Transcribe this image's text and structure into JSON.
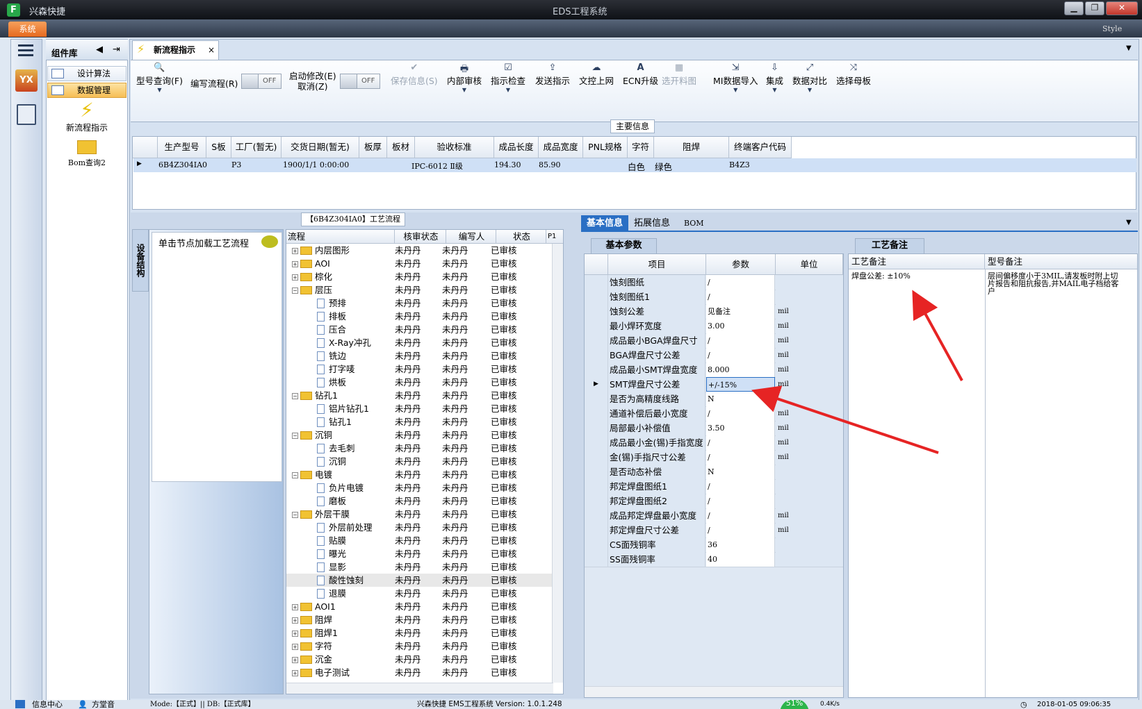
{
  "titlebar": {
    "app_name": "兴森快捷",
    "window_title": "EDS工程系统",
    "app_icon_letter": "F",
    "style_label": "Style",
    "min": "▁",
    "max": "❐",
    "close": "✕"
  },
  "ribbon": {
    "system_tab": "系统"
  },
  "sidebar": {
    "title": "组件库",
    "items": [
      {
        "label": "设计算法",
        "selected": false
      },
      {
        "label": "数据管理",
        "selected": true
      }
    ],
    "tools": [
      {
        "label": "新流程指示",
        "icon": "lightning-icon"
      },
      {
        "label": "Bom查询2",
        "icon": "folder-open-icon"
      }
    ]
  },
  "doc_tab": {
    "label": "新流程指示",
    "close": "×"
  },
  "toolbar": {
    "buttons": [
      {
        "label": "型号查询(F)",
        "icon": "🔍",
        "disabled": false
      },
      {
        "label": "编写流程(R)",
        "icon": "",
        "disabled": false
      },
      {
        "label": "启动修改(E)",
        "label2": "取消(Z)",
        "icon": "",
        "disabled": false
      },
      {
        "label": "保存信息(S)",
        "icon": "✔",
        "disabled": true
      },
      {
        "label": "内部审核",
        "icon": "🖶",
        "disabled": false
      },
      {
        "label": "指示检查",
        "icon": "☑",
        "disabled": false
      },
      {
        "label": "发送指示",
        "icon": "⇪",
        "disabled": false
      },
      {
        "label": "文控上网",
        "icon": "☁",
        "disabled": false
      },
      {
        "label": "ECN升级",
        "icon": "A",
        "disabled": false
      },
      {
        "label": "选开料图",
        "icon": "▦",
        "disabled": true
      },
      {
        "label": "MI数据导入",
        "icon": "⇲",
        "disabled": false
      },
      {
        "label": "集成",
        "icon": "⇩",
        "disabled": false
      },
      {
        "label": "数据对比",
        "icon": "⤢",
        "disabled": false
      },
      {
        "label": "选择母板",
        "icon": "⤨",
        "disabled": false
      }
    ],
    "toggle1": "OFF",
    "toggle2": "OFF"
  },
  "main_info": {
    "title": "主要信息",
    "columns": [
      "生产型号",
      "S板",
      "工厂(暂无)",
      "交货日期(暂无)",
      "板厚",
      "板材",
      "验收标准",
      "成品长度",
      "成品宽度",
      "PNL规格",
      "字符",
      "阻焊",
      "终端客户代码"
    ],
    "row": [
      "6B4Z304IA0",
      "",
      "P3",
      "1900/1/1 0:00:00",
      "",
      "",
      "IPC-6012 Ⅱ级",
      "194.30",
      "85.90",
      "",
      "白色",
      "绿色",
      "B4Z3"
    ]
  },
  "flow_panel": {
    "title": "【6B4Z304IA0】工艺流程",
    "side_tab": "设备结构",
    "hint": "单击节点加载工艺流程",
    "columns": [
      "流程",
      "核审状态",
      "编写人",
      "状态",
      "P1"
    ],
    "rows": [
      {
        "name": "内层图形",
        "type": "folder",
        "level": 0,
        "exp": "+",
        "a": "未丹丹",
        "b": "未丹丹",
        "c": "已审核"
      },
      {
        "name": "AOI",
        "type": "folder",
        "level": 0,
        "exp": "+",
        "a": "未丹丹",
        "b": "未丹丹",
        "c": "已审核"
      },
      {
        "name": "棕化",
        "type": "folder",
        "level": 0,
        "exp": "+",
        "a": "未丹丹",
        "b": "未丹丹",
        "c": "已审核"
      },
      {
        "name": "层压",
        "type": "folder",
        "level": 0,
        "exp": "−",
        "a": "未丹丹",
        "b": "未丹丹",
        "c": "已审核"
      },
      {
        "name": "预排",
        "type": "doc",
        "level": 1,
        "exp": "",
        "a": "未丹丹",
        "b": "未丹丹",
        "c": "已审核"
      },
      {
        "name": "排板",
        "type": "doc",
        "level": 1,
        "exp": "",
        "a": "未丹丹",
        "b": "未丹丹",
        "c": "已审核"
      },
      {
        "name": "压合",
        "type": "doc",
        "level": 1,
        "exp": "",
        "a": "未丹丹",
        "b": "未丹丹",
        "c": "已审核"
      },
      {
        "name": "X-Ray冲孔",
        "type": "doc",
        "level": 1,
        "exp": "",
        "a": "未丹丹",
        "b": "未丹丹",
        "c": "已审核"
      },
      {
        "name": "铣边",
        "type": "doc",
        "level": 1,
        "exp": "",
        "a": "未丹丹",
        "b": "未丹丹",
        "c": "已审核"
      },
      {
        "name": "打字唛",
        "type": "doc",
        "level": 1,
        "exp": "",
        "a": "未丹丹",
        "b": "未丹丹",
        "c": "已审核"
      },
      {
        "name": "烘板",
        "type": "doc",
        "level": 1,
        "exp": "",
        "a": "未丹丹",
        "b": "未丹丹",
        "c": "已审核"
      },
      {
        "name": "钻孔1",
        "type": "folder",
        "level": 0,
        "exp": "−",
        "a": "未丹丹",
        "b": "未丹丹",
        "c": "已审核"
      },
      {
        "name": "铝片钻孔1",
        "type": "doc",
        "level": 1,
        "exp": "",
        "a": "未丹丹",
        "b": "未丹丹",
        "c": "已审核"
      },
      {
        "name": "钻孔1",
        "type": "doc",
        "level": 1,
        "exp": "",
        "a": "未丹丹",
        "b": "未丹丹",
        "c": "已审核"
      },
      {
        "name": "沉铜",
        "type": "folder",
        "level": 0,
        "exp": "−",
        "a": "未丹丹",
        "b": "未丹丹",
        "c": "已审核"
      },
      {
        "name": "去毛刺",
        "type": "doc",
        "level": 1,
        "exp": "",
        "a": "未丹丹",
        "b": "未丹丹",
        "c": "已审核"
      },
      {
        "name": "沉铜",
        "type": "doc",
        "level": 1,
        "exp": "",
        "a": "未丹丹",
        "b": "未丹丹",
        "c": "已审核"
      },
      {
        "name": "电镀",
        "type": "folder",
        "level": 0,
        "exp": "−",
        "a": "未丹丹",
        "b": "未丹丹",
        "c": "已审核"
      },
      {
        "name": "负片电镀",
        "type": "doc",
        "level": 1,
        "exp": "",
        "a": "未丹丹",
        "b": "未丹丹",
        "c": "已审核"
      },
      {
        "name": "磨板",
        "type": "doc",
        "level": 1,
        "exp": "",
        "a": "未丹丹",
        "b": "未丹丹",
        "c": "已审核"
      },
      {
        "name": "外层干膜",
        "type": "folder",
        "level": 0,
        "exp": "−",
        "a": "未丹丹",
        "b": "未丹丹",
        "c": "已审核"
      },
      {
        "name": "外层前处理",
        "type": "doc",
        "level": 1,
        "exp": "",
        "a": "未丹丹",
        "b": "未丹丹",
        "c": "已审核"
      },
      {
        "name": "贴膜",
        "type": "doc",
        "level": 1,
        "exp": "",
        "a": "未丹丹",
        "b": "未丹丹",
        "c": "已审核"
      },
      {
        "name": "曝光",
        "type": "doc",
        "level": 1,
        "exp": "",
        "a": "未丹丹",
        "b": "未丹丹",
        "c": "已审核"
      },
      {
        "name": "显影",
        "type": "doc",
        "level": 1,
        "exp": "",
        "a": "未丹丹",
        "b": "未丹丹",
        "c": "已审核"
      },
      {
        "name": "酸性蚀刻",
        "type": "doc",
        "level": 1,
        "exp": "",
        "a": "未丹丹",
        "b": "未丹丹",
        "c": "已审核",
        "sel": true
      },
      {
        "name": "退膜",
        "type": "doc",
        "level": 1,
        "exp": "",
        "a": "未丹丹",
        "b": "未丹丹",
        "c": "已审核"
      },
      {
        "name": "AOI1",
        "type": "folder",
        "level": 0,
        "exp": "+",
        "a": "未丹丹",
        "b": "未丹丹",
        "c": "已审核"
      },
      {
        "name": "阻焊",
        "type": "folder",
        "level": 0,
        "exp": "+",
        "a": "未丹丹",
        "b": "未丹丹",
        "c": "已审核"
      },
      {
        "name": "阻焊1",
        "type": "folder",
        "level": 0,
        "exp": "+",
        "a": "未丹丹",
        "b": "未丹丹",
        "c": "已审核"
      },
      {
        "name": "字符",
        "type": "folder",
        "level": 0,
        "exp": "+",
        "a": "未丹丹",
        "b": "未丹丹",
        "c": "已审核"
      },
      {
        "name": "沉金",
        "type": "folder",
        "level": 0,
        "exp": "+",
        "a": "未丹丹",
        "b": "未丹丹",
        "c": "已审核"
      },
      {
        "name": "电子测试",
        "type": "folder",
        "level": 0,
        "exp": "+",
        "a": "未丹丹",
        "b": "未丹丹",
        "c": "已审核"
      }
    ]
  },
  "right_tabs": [
    "基本信息",
    "拓展信息",
    "BOM"
  ],
  "params": {
    "subtab": "基本参数",
    "columns": [
      "项目",
      "参数",
      "单位"
    ],
    "rows": [
      {
        "k": "蚀刻图纸",
        "v": "/",
        "u": ""
      },
      {
        "k": "蚀刻图纸1",
        "v": "/",
        "u": ""
      },
      {
        "k": "蚀刻公差",
        "v": "见备注",
        "u": "mil"
      },
      {
        "k": "最小焊环宽度",
        "v": "3.00",
        "u": "mil"
      },
      {
        "k": "成品最小BGA焊盘尺寸",
        "v": "/",
        "u": "mil"
      },
      {
        "k": "BGA焊盘尺寸公差",
        "v": "/",
        "u": "mil"
      },
      {
        "k": "成品最小SMT焊盘宽度",
        "v": "8.000",
        "u": "mil"
      },
      {
        "k": "SMT焊盘尺寸公差",
        "v": "+/-15%",
        "u": "mil",
        "cur": true
      },
      {
        "k": "是否为高精度线路",
        "v": "N",
        "u": ""
      },
      {
        "k": "通道补偿后最小宽度",
        "v": "/",
        "u": "mil"
      },
      {
        "k": "局部最小补偿值",
        "v": "3.50",
        "u": "mil"
      },
      {
        "k": "成品最小金(锡)手指宽度",
        "v": "/",
        "u": "mil"
      },
      {
        "k": "金(锡)手指尺寸公差",
        "v": "/",
        "u": "mil"
      },
      {
        "k": "是否动态补偿",
        "v": "N",
        "u": ""
      },
      {
        "k": "邦定焊盘图纸1",
        "v": "/",
        "u": ""
      },
      {
        "k": "邦定焊盘图纸2",
        "v": "/",
        "u": ""
      },
      {
        "k": "成品邦定焊盘最小宽度",
        "v": "/",
        "u": "mil"
      },
      {
        "k": "邦定焊盘尺寸公差",
        "v": "/",
        "u": "mil"
      },
      {
        "k": "CS面残铜率",
        "v": "36",
        "u": ""
      },
      {
        "k": "SS面残铜率",
        "v": "40",
        "u": ""
      }
    ]
  },
  "notes": {
    "subtab": "工艺备注",
    "col1": "工艺备注",
    "col2": "型号备注",
    "text1": "焊盘公差: ±10%",
    "text2": "层间偏移度小于3MIL,请发板时附上切片报告和阻抗报告,并MAIL电子档给客户"
  },
  "status": {
    "info_center": "信息中心",
    "user": "方堂音",
    "mode": "Mode:【正式】|| DB:【正式库】",
    "version": "兴森快捷 EMS工程系统 Version: 1.0.1.248",
    "cpu": "51%",
    "net": "0.4K/s",
    "datetime": "2018-01-05 09:06:35"
  },
  "colors": {
    "accent": "#2a6fc4",
    "arrow": "#e62424",
    "orange": "#e5691f"
  }
}
